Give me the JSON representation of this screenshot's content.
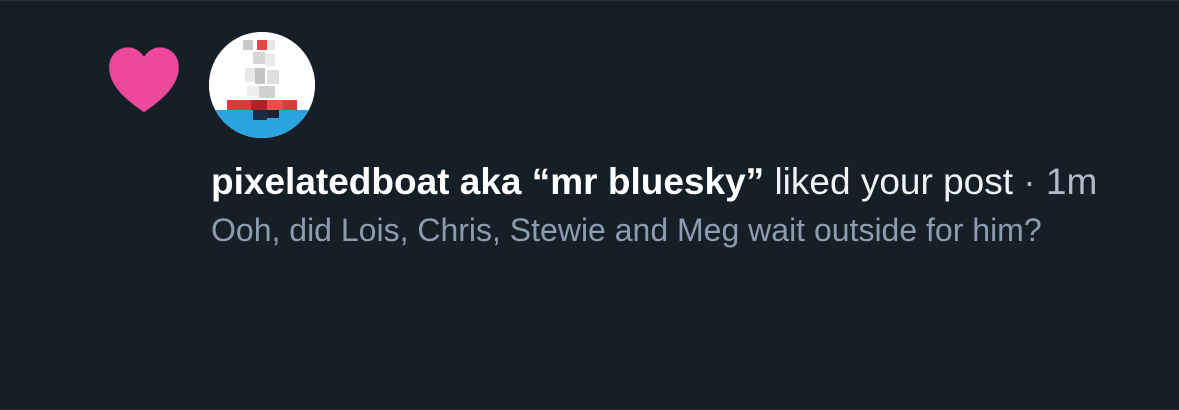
{
  "notification": {
    "type": "like",
    "author": "pixelatedboat aka “mr bluesky”",
    "action": " liked your post",
    "separator": " · ",
    "time": "1m",
    "excerpt": "Ooh, did Lois, Chris, Stewie and Meg wait outside for him?",
    "icon": "heart-icon",
    "colors": {
      "background": "#161e27",
      "heart": "#ec4899",
      "author_text": "#ffffff",
      "secondary_text": "#8c9cb0"
    }
  }
}
